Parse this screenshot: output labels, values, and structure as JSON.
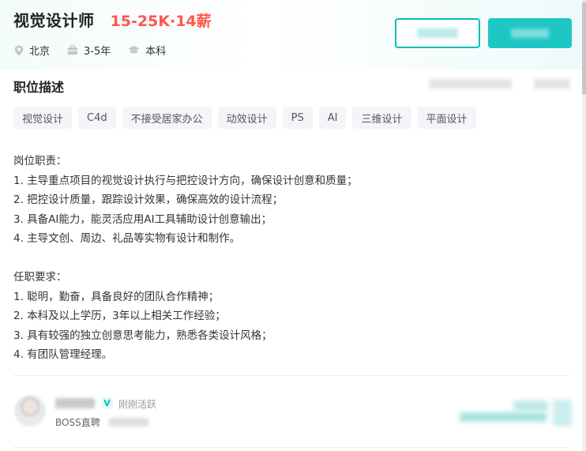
{
  "job": {
    "title": "视觉设计师",
    "salary": "15-25K·14薪",
    "location": "北京",
    "experience": "3-5年",
    "education": "本科"
  },
  "section": {
    "title": "职位描述"
  },
  "tags": [
    "视觉设计",
    "C4d",
    "不接受居家办公",
    "动效设计",
    "PS",
    "AI",
    "三维设计",
    "平面设计"
  ],
  "description": [
    "岗位职责：",
    "1. 主导重点项目的视觉设计执行与把控设计方向，确保设计创意和质量；",
    "2. 把控设计质量，跟踪设计效果，确保高效的设计流程；",
    "3. 具备AI能力，能灵活应用AI工具辅助设计创意输出；",
    "4. 主导文创、周边、礼品等实物有设计和制作。",
    "",
    "任职要求：",
    "1. 聪明，勤奋，具备良好的团队合作精神；",
    "2. 本科及以上学历，3年以上相关工作经验；",
    "3. 具有较强的独立创意思考能力，熟悉各类设计风格；",
    "4. 有团队管理经理。"
  ],
  "boss": {
    "verified_badge": "V",
    "status": "刚刚活跃",
    "role": "BOSS直聘"
  },
  "icons": {
    "location": "location-pin-icon",
    "experience": "briefcase-icon",
    "education": "graduation-cap-icon"
  },
  "colors": {
    "salary": "#fe574a",
    "accent": "#00bebd",
    "tag_bg": "#f3f5f8"
  }
}
